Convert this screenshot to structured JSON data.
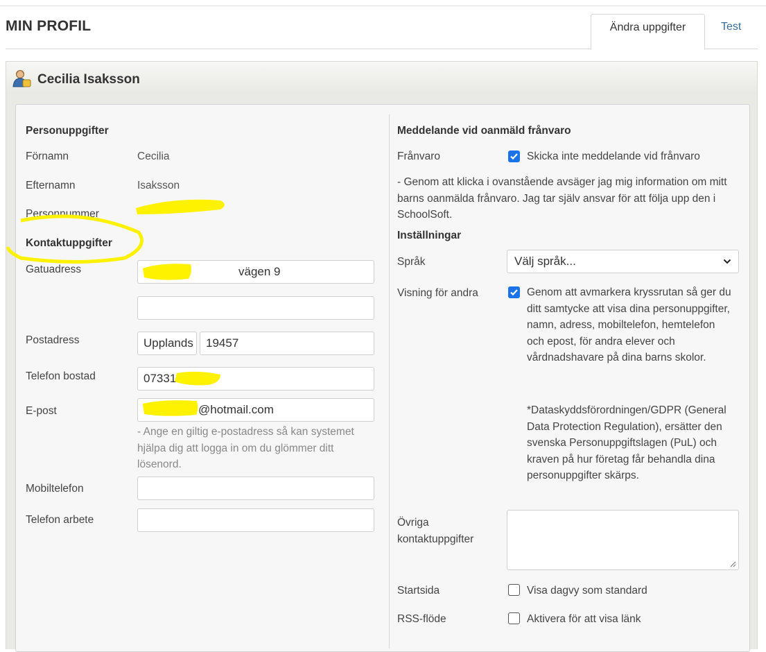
{
  "page": {
    "title": "MIN PROFIL"
  },
  "tabs": [
    {
      "label": "Ändra uppgifter",
      "active": true
    },
    {
      "label": "Test",
      "active": false
    }
  ],
  "user": {
    "name": "Cecilia Isaksson",
    "icon": "user-icon"
  },
  "personal": {
    "heading": "Personuppgifter",
    "first_name_label": "Förnamn",
    "first_name": "Cecilia",
    "last_name_label": "Efternamn",
    "last_name": "Isaksson",
    "personal_number_label": "Personnummer"
  },
  "contact": {
    "heading": "Kontaktuppgifter",
    "street_label": "Gatuadress",
    "street_value": "vägen 9",
    "street2_value": "",
    "postal_label": "Postadress",
    "city_value": "Upplands",
    "zip_value": "19457",
    "home_phone_label": "Telefon bostad",
    "home_phone_value": "07331",
    "email_label": "E-post",
    "email_value": "@hotmail.com",
    "email_help": "- Ange en giltig e-postadress så kan systemet hjälpa dig att logga in om du glömmer ditt lösenord.",
    "mobile_label": "Mobiltelefon",
    "mobile_value": "",
    "work_phone_label": "Telefon arbete",
    "work_phone_value": ""
  },
  "absence": {
    "heading": "Meddelande vid oanmäld frånvaro",
    "label": "Frånvaro",
    "checkbox_label": "Skicka inte meddelande vid frånvaro",
    "checked": true,
    "note": "- Genom att klicka i ovanstående avsäger jag mig information om mitt barns oanmälda frånvaro. Jag tar själv ansvar för att följa upp den i SchoolSoft."
  },
  "settings": {
    "heading": "Inställningar",
    "language_label": "Språk",
    "language_value": "Välj språk...",
    "visibility_label": "Visning för andra",
    "visibility_checked": true,
    "visibility_text": "Genom att avmarkera kryssrutan så ger du ditt samtycke att visa dina personuppgifter, namn, adress, mobiltelefon, hemtelefon och epost, för andra elever och vårdnadshavare på dina barns skolor.",
    "gdpr_text": "*Dataskyddsförordningen/GDPR (General Data Protection Regulation), ersätter den svenska Personuppgiftslagen (PuL) och kraven på hur företag får behandla dina personuppgifter skärps.",
    "other_contact_label": "Övriga kontaktuppgifter",
    "other_contact_value": "",
    "startpage_label": "Startsida",
    "startpage_checkbox_label": "Visa dagvy som standard",
    "startpage_checked": false,
    "rss_label": "RSS-flöde",
    "rss_checkbox_label": "Aktivera för att visa länk",
    "rss_checked": false
  },
  "colors": {
    "accent": "#1a73e8",
    "link": "#3a6d97",
    "highlight": "#ffff00"
  }
}
